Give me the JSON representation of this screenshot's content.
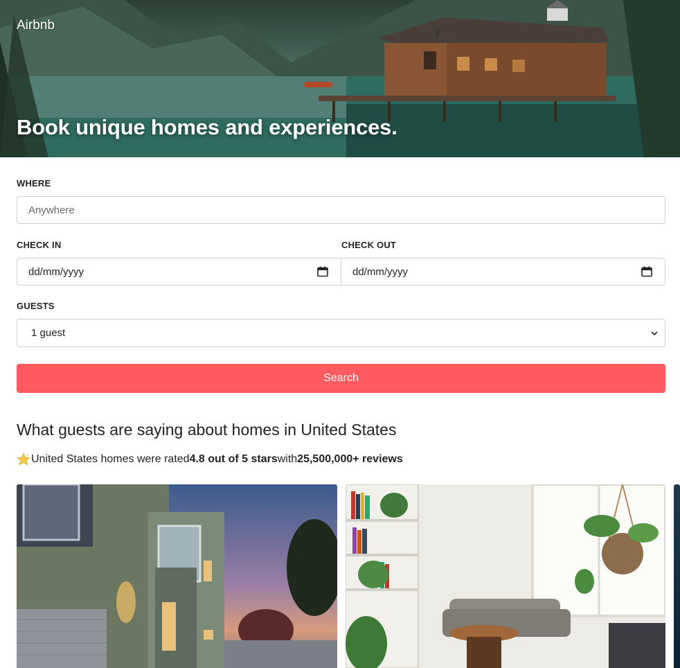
{
  "header": {
    "brand": "Airbnb",
    "title": "Book unique homes and experiences."
  },
  "form": {
    "where": {
      "label": "WHERE",
      "placeholder": "Anywhere"
    },
    "check_in": {
      "label": "CHECK IN",
      "value": "dd/mm/yyyy"
    },
    "check_out": {
      "label": "CHECK OUT",
      "value": "dd/mm/yyyy"
    },
    "guests": {
      "label": "GUESTS",
      "value": "1 guest"
    },
    "search_label": "Search"
  },
  "reviews": {
    "heading": "What guests are saying about homes in United States",
    "prefix": "United States homes were rated ",
    "rating": "4.8 out of 5 stars",
    "middle": " with ",
    "count": "25,500,000+ reviews"
  },
  "icons": {
    "calendar": "calendar-icon",
    "chevron": "chevron-down-icon",
    "star": "star-icon"
  },
  "colors": {
    "accent": "#ff5a5f",
    "text": "#222222",
    "border": "#cfcfcf"
  }
}
